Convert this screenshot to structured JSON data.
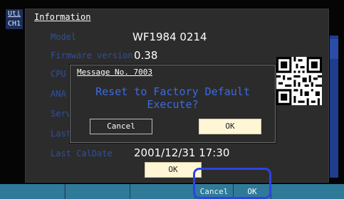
{
  "sidebar": {
    "mode_label": "Uti",
    "channel_label": "CH1"
  },
  "info": {
    "title": "Information",
    "rows": [
      {
        "label": "Model",
        "value": "WF1984  0214"
      },
      {
        "label": "Firmware version",
        "value": "0.38"
      },
      {
        "label": "CPU",
        "value": ""
      },
      {
        "label": "ANA",
        "value": ""
      },
      {
        "label": "Serv",
        "value": ""
      },
      {
        "label": "Last",
        "value": ""
      },
      {
        "label": "Last CalDate",
        "value": "2001/12/31 17:30"
      }
    ],
    "ok_label": "OK"
  },
  "dialog": {
    "title": "Message No. 7003",
    "line1": "Reset to Factory Default",
    "line2": "Execute?",
    "cancel_label": "Cancel",
    "ok_label": "OK"
  },
  "softkeys": {
    "cancel_label": "Cancel",
    "ok_label": "OK"
  },
  "colors": {
    "label_blue": "#2f4f9e",
    "message_blue": "#3d6ae0",
    "ok_fill": "#fff6d6",
    "softkey_bar": "#2e6b86",
    "highlight_ring": "#2a44e6"
  },
  "icons": {
    "qr": "qr-code-icon"
  }
}
